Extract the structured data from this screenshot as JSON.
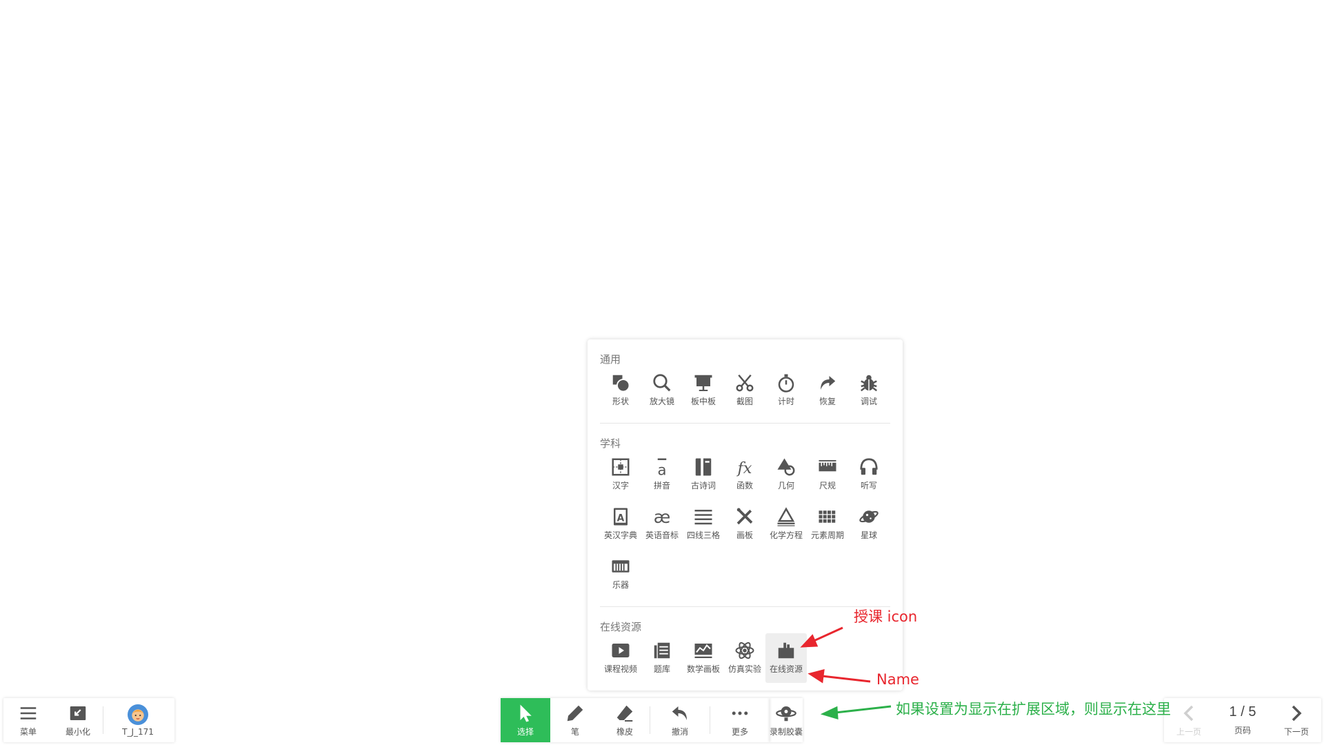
{
  "panel": {
    "sections": [
      {
        "title": "通用",
        "items": [
          {
            "label": "形状",
            "icon": "shape-icon"
          },
          {
            "label": "放大镜",
            "icon": "magnifier-icon"
          },
          {
            "label": "板中板",
            "icon": "board-in-board-icon"
          },
          {
            "label": "截图",
            "icon": "scissors-icon"
          },
          {
            "label": "计时",
            "icon": "stopwatch-icon"
          },
          {
            "label": "恢复",
            "icon": "redo-arrow-icon"
          },
          {
            "label": "调试",
            "icon": "bug-icon"
          }
        ]
      },
      {
        "title": "学科",
        "items": [
          {
            "label": "汉字",
            "icon": "chinese-grid-icon"
          },
          {
            "label": "拼音",
            "icon": "pinyin-icon"
          },
          {
            "label": "古诗词",
            "icon": "book-icon"
          },
          {
            "label": "函数",
            "icon": "function-icon"
          },
          {
            "label": "几何",
            "icon": "geometry-icon"
          },
          {
            "label": "尺规",
            "icon": "ruler-icon"
          },
          {
            "label": "听写",
            "icon": "headphones-icon"
          },
          {
            "label": "英汉字典",
            "icon": "dictionary-icon"
          },
          {
            "label": "英语音标",
            "icon": "phonetic-icon"
          },
          {
            "label": "四线三格",
            "icon": "four-lines-icon"
          },
          {
            "label": "画板",
            "icon": "drawing-tools-icon"
          },
          {
            "label": "化学方程",
            "icon": "chemistry-icon"
          },
          {
            "label": "元素周期",
            "icon": "periodic-table-icon"
          },
          {
            "label": "星球",
            "icon": "planet-icon"
          },
          {
            "label": "乐器",
            "icon": "piano-icon"
          }
        ]
      },
      {
        "title": "在线资源",
        "items": [
          {
            "label": "课程视频",
            "icon": "video-icon"
          },
          {
            "label": "题库",
            "icon": "question-bank-icon"
          },
          {
            "label": "数学画板",
            "icon": "math-board-icon"
          },
          {
            "label": "仿真实验",
            "icon": "atom-icon"
          },
          {
            "label": "在线资源",
            "icon": "teaching-icon",
            "active": true
          }
        ]
      }
    ]
  },
  "left_bar": {
    "menu_label": "菜单",
    "minimize_label": "最小化",
    "user_label": "T_J_171"
  },
  "center_bar": {
    "select_label": "选择",
    "pen_label": "笔",
    "eraser_label": "橡皮",
    "undo_label": "撤消",
    "more_label": "更多",
    "record_label": "录制胶囊"
  },
  "right_bar": {
    "prev_label": "上一页",
    "page_value": "1 / 5",
    "page_label": "页码",
    "next_label": "下一页"
  },
  "annotations": {
    "icon_note": "授课  icon",
    "name_note": "Name",
    "extension_note": "如果设置为显示在扩展区域，则显示在这里"
  },
  "colors": {
    "accent": "#2ebd59",
    "annotation_red": "#e8262e",
    "annotation_green": "#2cb04a"
  }
}
